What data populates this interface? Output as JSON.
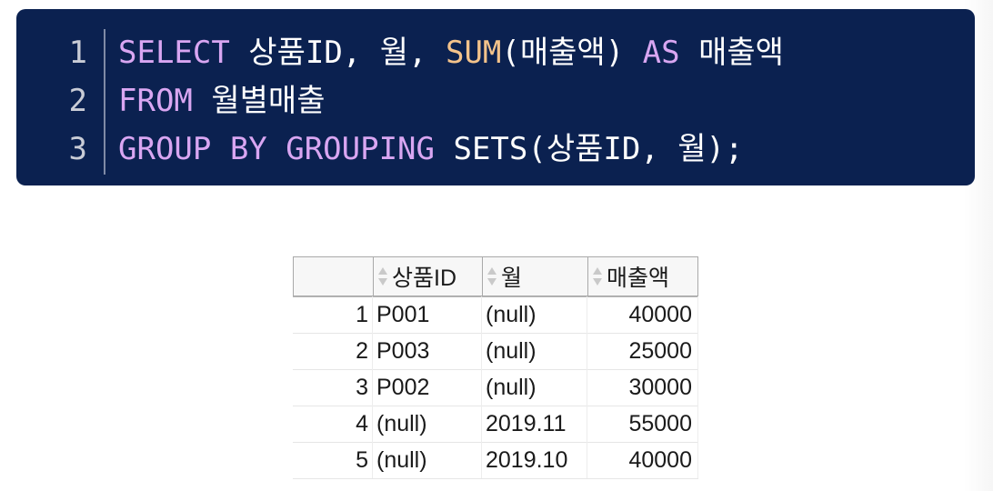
{
  "code": {
    "line_numbers": [
      "1",
      "2",
      "3"
    ],
    "lines": [
      [
        {
          "t": "SELECT",
          "k": "kw"
        },
        {
          "t": " 상품ID, 월, ",
          "k": "tx"
        },
        {
          "t": "SUM",
          "k": "fn"
        },
        {
          "t": "(매출액) ",
          "k": "tx"
        },
        {
          "t": "AS",
          "k": "kw"
        },
        {
          "t": " 매출액",
          "k": "tx"
        }
      ],
      [
        {
          "t": "FROM",
          "k": "kw"
        },
        {
          "t": " 월별매출",
          "k": "tx"
        }
      ],
      [
        {
          "t": "GROUP BY GROUPING",
          "k": "kw"
        },
        {
          "t": " SETS(상품ID, 월);",
          "k": "tx"
        }
      ]
    ],
    "colors": {
      "background": "#0b2150",
      "keyword": "#d9a6f2",
      "function": "#f4c38b",
      "text": "#ffffff"
    }
  },
  "result_grid": {
    "columns": [
      "상품ID",
      "월",
      "매출액"
    ],
    "rows": [
      {
        "num": "1",
        "id": "P001",
        "month": "(null)",
        "sales": "40000"
      },
      {
        "num": "2",
        "id": "P003",
        "month": "(null)",
        "sales": "25000"
      },
      {
        "num": "3",
        "id": "P002",
        "month": "(null)",
        "sales": "30000"
      },
      {
        "num": "4",
        "id": "(null)",
        "month": "2019.11",
        "sales": "55000"
      },
      {
        "num": "5",
        "id": "(null)",
        "month": "2019.10",
        "sales": "40000"
      }
    ],
    "sort_icon": "sort-updown-icon"
  }
}
